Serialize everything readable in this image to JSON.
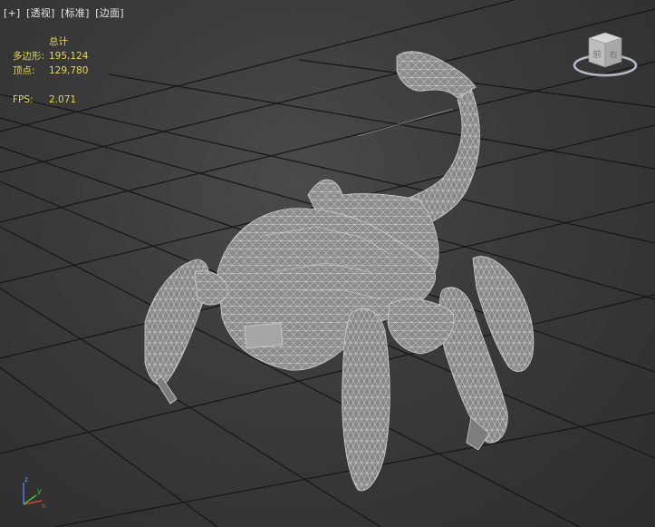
{
  "viewport": {
    "menu": {
      "plus": "[+]",
      "view": "[透视]",
      "shading_style": "[标准]",
      "display_mode": "[边面]"
    },
    "stats": {
      "header": "总计",
      "polygons_label": "多边形:",
      "polygons_value": "195,124",
      "vertices_label": "顶点:",
      "vertices_value": "129,780",
      "fps_label": "FPS:",
      "fps_value": "2.071"
    },
    "viewcube": {
      "face_front": "前",
      "face_right": "右",
      "icon": "viewcube-icon"
    },
    "axis": {
      "z_label": "z",
      "x_label": "x",
      "y_label": "y",
      "colors": {
        "x": "#e0402a",
        "y": "#3ec43e",
        "z": "#4a78e8"
      }
    },
    "colors": {
      "stats_text": "#e7d64a",
      "menu_text": "#e6e6e6",
      "grid_line": "#151515",
      "model_fill": "#8a8a8a",
      "wire": "#d9d9d9"
    }
  }
}
